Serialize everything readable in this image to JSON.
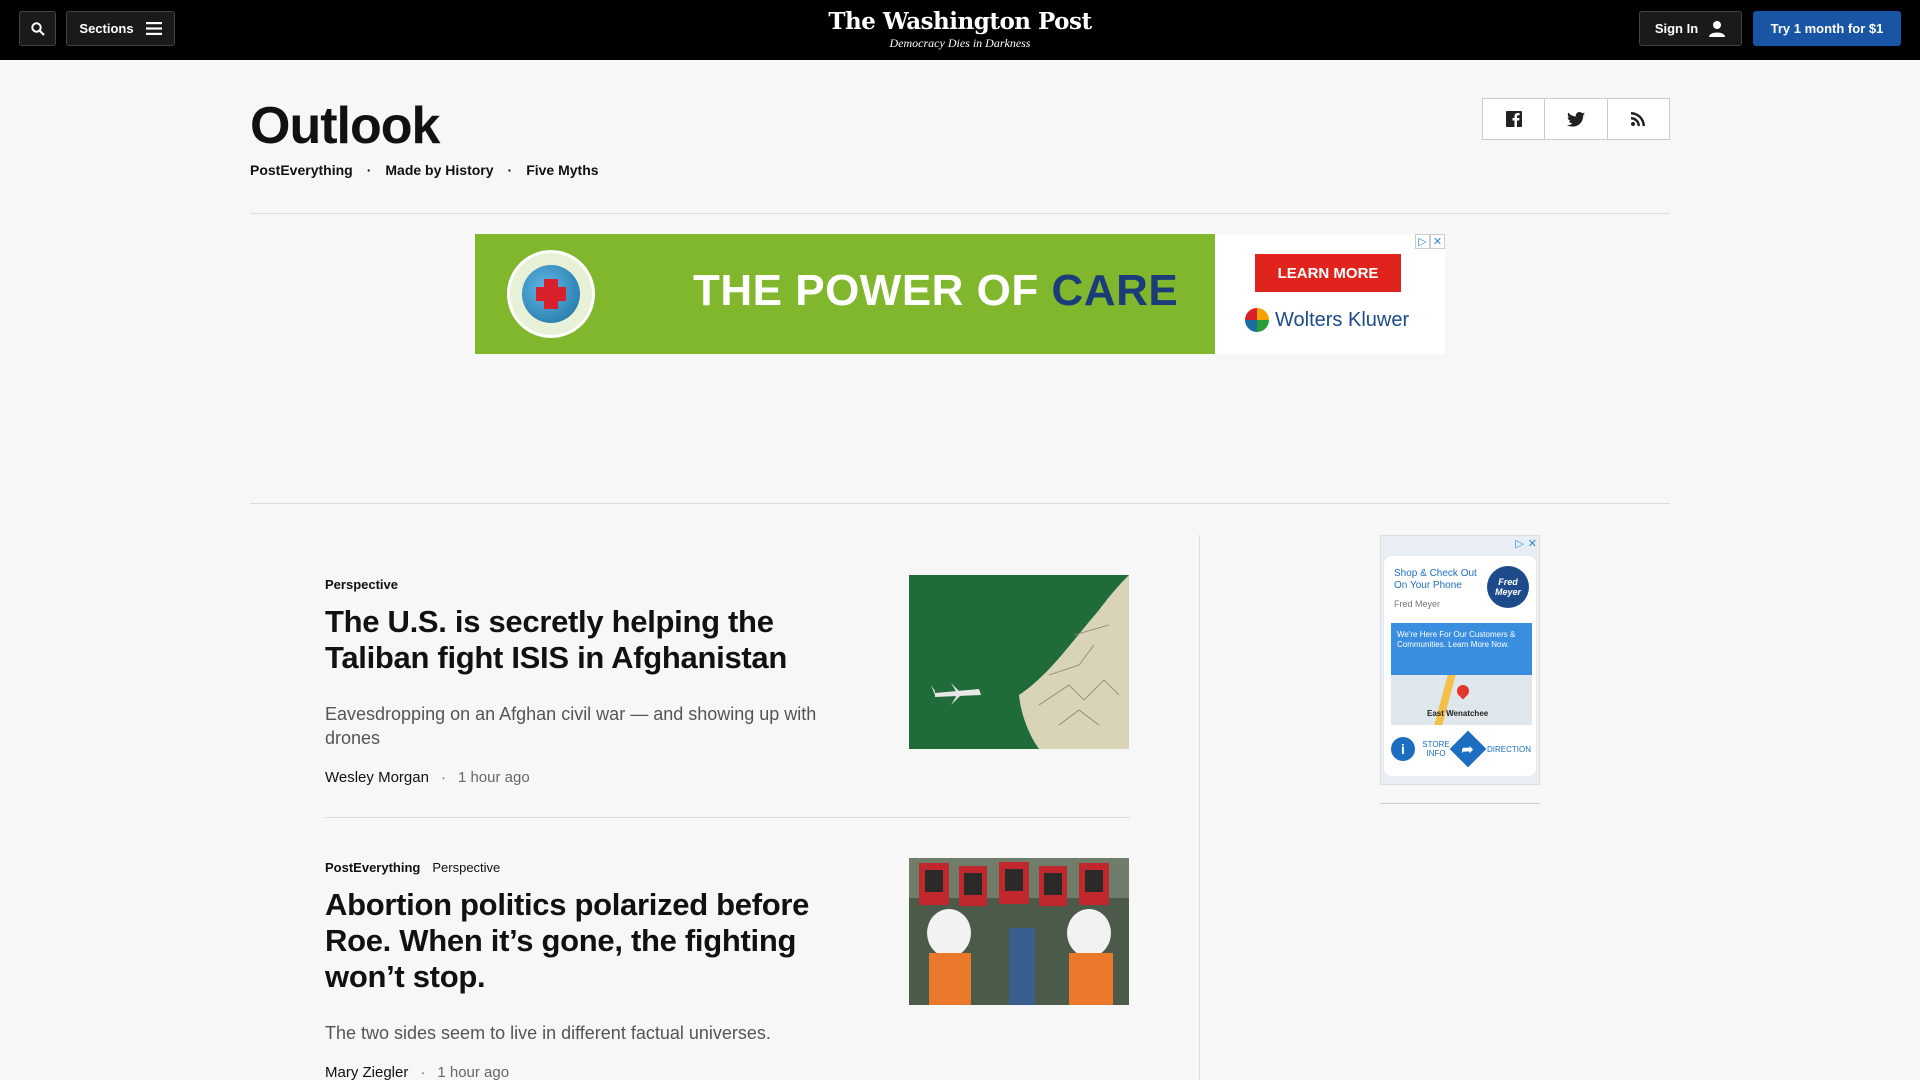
{
  "header": {
    "sections_label": "Sections",
    "logo_name": "The Washington Post",
    "logo_tagline": "Democracy Dies in Darkness",
    "signin_label": "Sign In",
    "subscribe_label": "Try 1 month for $1"
  },
  "page": {
    "title": "Outlook",
    "subnav": [
      "PostEverything",
      "Made by History",
      "Five Myths"
    ]
  },
  "banner_ad": {
    "headline_main": "THE POWER OF",
    "headline_accent": "CARE",
    "cta": "LEARN MORE",
    "brand": "Wolters Kluwer",
    "colors": {
      "background": "#80b72c",
      "cta": "#e1231e",
      "accent": "#1b3c7a"
    }
  },
  "articles": [
    {
      "kickers": [
        "Perspective"
      ],
      "headline": "The U.S. is secretly helping the Taliban fight ISIS in Afghanistan",
      "blurb": "Eavesdropping on an Afghan civil war — and showing up with drones",
      "author": "Wesley Morgan",
      "time": "1 hour ago"
    },
    {
      "kickers": [
        "PostEverything",
        "Perspective"
      ],
      "headline": "Abortion politics polarized before Roe. When it’s gone, the fighting won’t stop.",
      "blurb": "The two sides seem to live in different factual universes.",
      "author": "Mary Ziegler",
      "time": "1 hour ago"
    }
  ],
  "side_ad": {
    "title": "Shop & Check Out On Your Phone",
    "logo_text": "Fred Meyer",
    "brand": "Fred Meyer",
    "box_text": "We're Here For Our Customers & Communities. Learn More Now.",
    "city": "East Wenatchee",
    "store_info": "STORE INFO",
    "directions": "DIRECTION"
  },
  "colors": {
    "topbar": "#000000",
    "subscribe_button": "#1955a5",
    "page_bg": "#f7f7f7"
  }
}
